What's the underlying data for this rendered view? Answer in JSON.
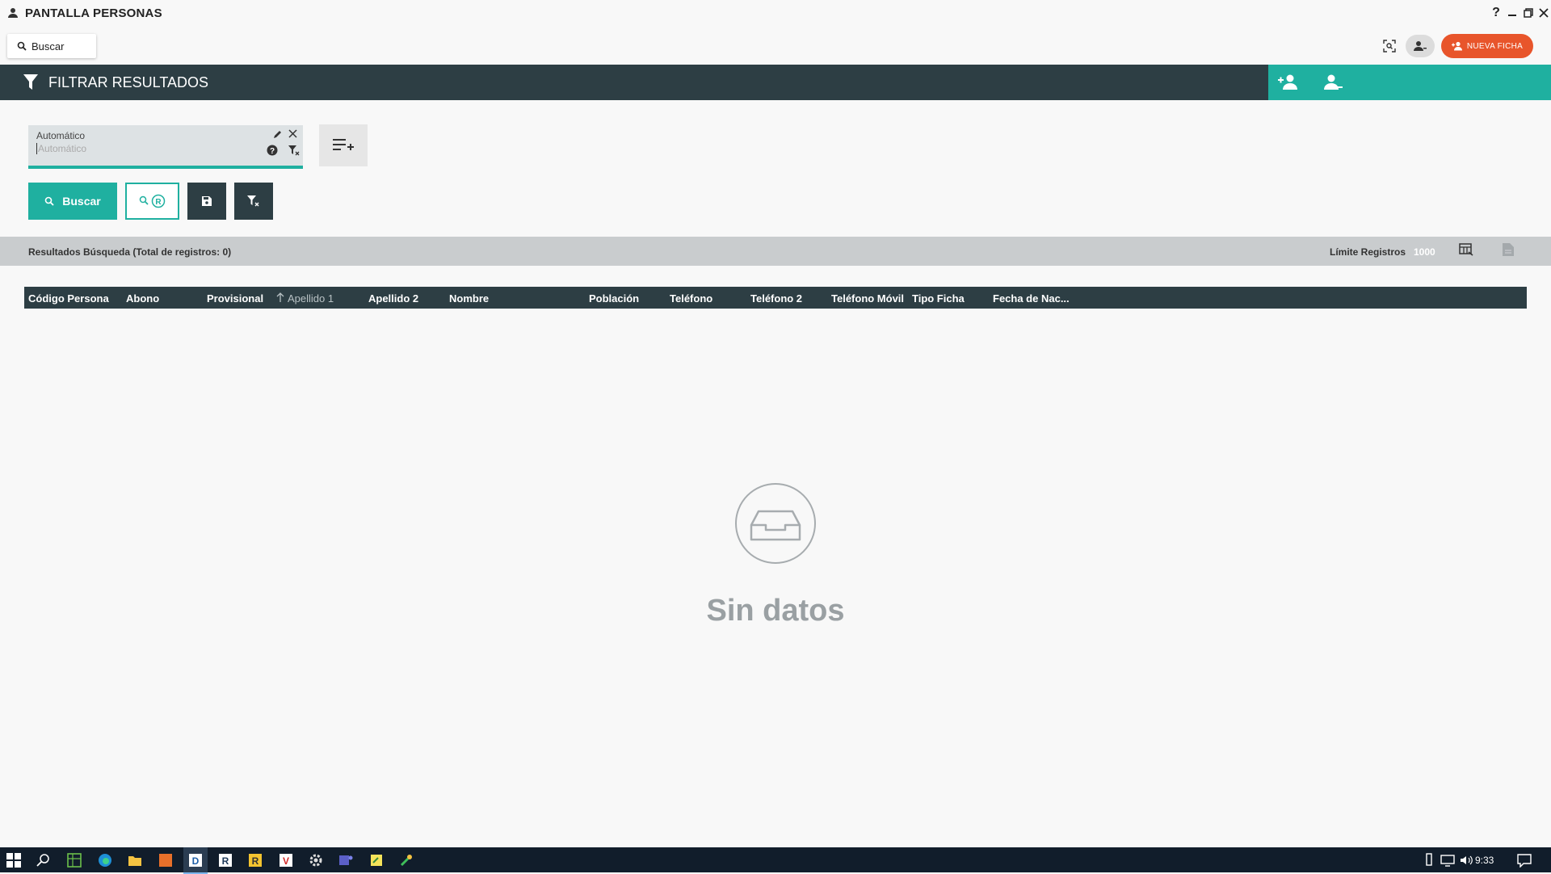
{
  "window": {
    "title": "PANTALLA PERSONAS"
  },
  "toolbar": {
    "search_label": "Buscar",
    "new_record_label": "NUEVA FICHA"
  },
  "filter_panel": {
    "title": "FILTRAR RESULTADOS",
    "chip": {
      "label": "Automático",
      "placeholder": "Automático"
    }
  },
  "actions": {
    "search_label": "Buscar"
  },
  "results": {
    "summary": "Resultados Búsqueda (Total de registros: 0)",
    "limit_label": "Límite Registros",
    "limit_value": "1000"
  },
  "table": {
    "columns": [
      "Código Persona",
      "Abono",
      "Provisional",
      "Apellido 1",
      "Apellido 2",
      "Nombre",
      "Población",
      "Teléfono",
      "Teléfono 2",
      "Teléfono Móvil",
      "Tipo Ficha",
      "Fecha de Nac..."
    ],
    "sorted_column": "Apellido 1",
    "sort_direction": "ascending",
    "empty_text": "Sin datos"
  },
  "taskbar": {
    "clock": "9:33"
  },
  "colors": {
    "accent": "#1fb0a0",
    "header_dark": "#2d3e44",
    "new_button": "#e8552b",
    "taskbar": "#111d2b"
  }
}
